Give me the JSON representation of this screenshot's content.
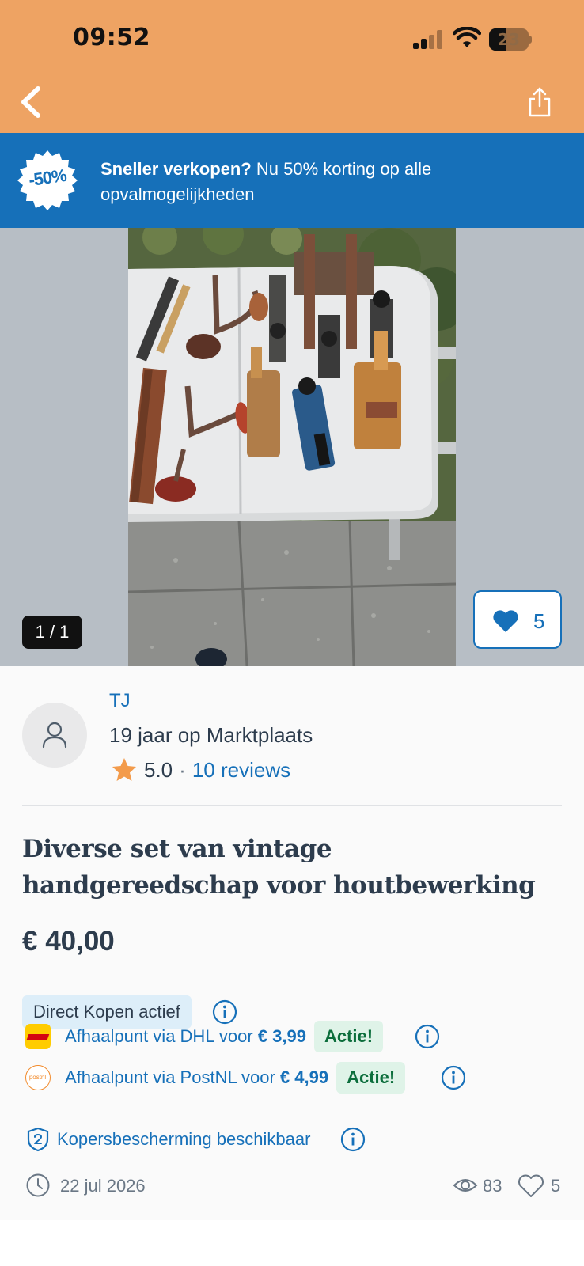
{
  "status_bar": {
    "time": "09:52",
    "battery_level": "23"
  },
  "header": {
    "back_icon": "chevron-left-icon",
    "share_icon": "share-icon"
  },
  "promo": {
    "badge": "-50%",
    "bold_text": "Sneller verkopen?",
    "text": " Nu 50% korting op alle opvalmogelijkheden"
  },
  "gallery": {
    "counter": "1 / 1",
    "favorite_count": "5"
  },
  "seller": {
    "name": "TJ",
    "years": "19 jaar op Marktplaats",
    "rating": "5.0",
    "separator": "·",
    "reviews_link": "10 reviews"
  },
  "listing": {
    "title": "Diverse set van vintage handgereedschap voor houtbewerking",
    "price": "€ 40,00",
    "direct_buy_label": "Direct Kopen actief"
  },
  "shipping": [
    {
      "logo": "dhl-logo",
      "text": "Afhaalpunt via DHL voor ",
      "price": "€ 3,99",
      "badge": "Actie!"
    },
    {
      "logo": "postnl-logo",
      "logo_text": "postnl",
      "text": "Afhaalpunt via PostNL voor ",
      "price": "€ 4,99",
      "badge": "Actie!"
    }
  ],
  "protection": {
    "text": "Kopersbescherming beschikbaar"
  },
  "meta": {
    "date": "22 jul 2026",
    "views": "83",
    "favorites": "5"
  },
  "colors": {
    "header_bg": "#eea363",
    "promo_bg": "#1670b9",
    "link": "#1670b9",
    "text": "#2d3c4d",
    "badge_green_bg": "#dff3e8",
    "badge_green_text": "#0c6e3c",
    "star": "#f39b4b"
  }
}
